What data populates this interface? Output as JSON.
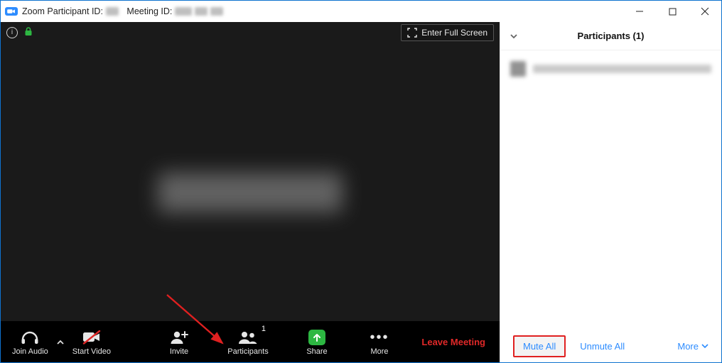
{
  "titlebar": {
    "participant_id_label": "Zoom Participant ID:",
    "meeting_id_label": "Meeting ID:"
  },
  "video": {
    "fullscreen_label": "Enter Full Screen"
  },
  "toolbar": {
    "join_audio": "Join Audio",
    "start_video": "Start Video",
    "invite": "Invite",
    "participants": "Participants",
    "participants_badge": "1",
    "share": "Share",
    "more": "More",
    "leave": "Leave Meeting"
  },
  "panel": {
    "title": "Participants (1)",
    "mute_all": "Mute All",
    "unmute_all": "Unmute All",
    "more": "More"
  },
  "colors": {
    "accent": "#2D8CFF",
    "share_green": "#2DB742",
    "leave_red": "#e02828",
    "highlight_border": "#e02020"
  }
}
